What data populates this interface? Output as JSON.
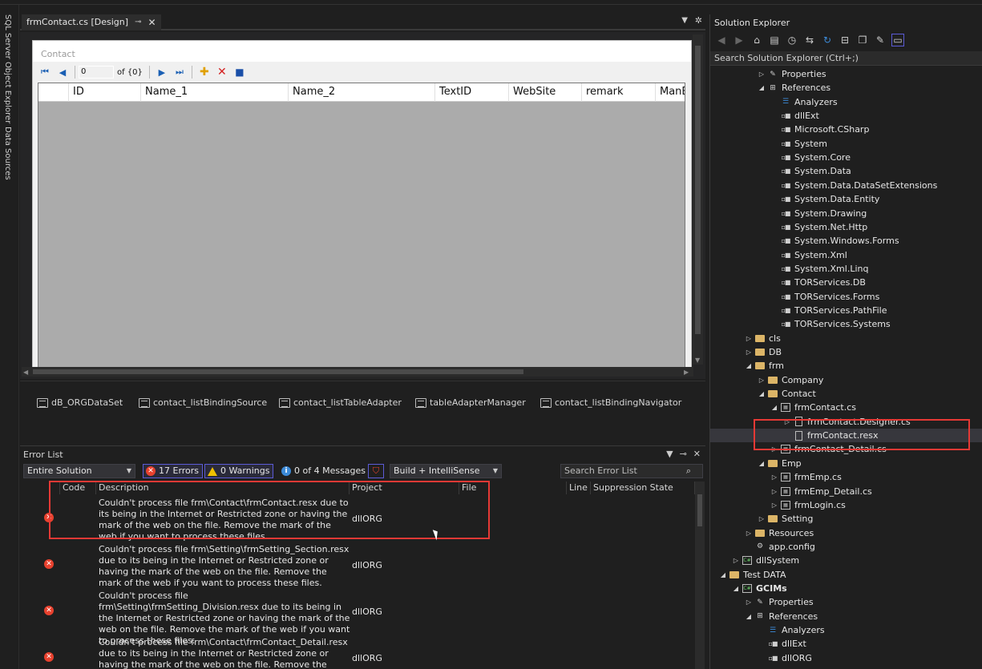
{
  "left_rail": [
    "SQL Server Object Explorer",
    "Data Sources"
  ],
  "designer": {
    "tab_label": "frmContact.cs [Design]",
    "form_title": "Contact",
    "navigator": {
      "position": "0",
      "count": "of {0}"
    },
    "columns": [
      "ID",
      "Name_1",
      "Name_2",
      "TextID",
      "WebSite",
      "remark",
      "ManEd"
    ]
  },
  "tray": [
    "dB_ORGDataSet",
    "contact_listBindingSource",
    "contact_listTableAdapter",
    "tableAdapterManager",
    "contact_listBindingNavigator"
  ],
  "error_list": {
    "title": "Error List",
    "scope": "Entire Solution",
    "errors": "17 Errors",
    "warnings": "0 Warnings",
    "messages": "0 of 4 Messages",
    "build_filter": "Build + IntelliSense",
    "search_placeholder": "Search Error List",
    "headers": [
      "Code",
      "Description",
      "Project",
      "File",
      "Line",
      "Suppression State"
    ],
    "rows": [
      {
        "description": "Couldn't process file frm\\Contact\\frmContact.resx due to its being in the Internet or Restricted zone or having the mark of the web on the file. Remove the mark of the web if you want to process these files.",
        "project": "dllORG"
      },
      {
        "description": "Couldn't process file frm\\Setting\\frmSetting_Section.resx due to its being in the Internet or Restricted zone or having the mark of the web on the file. Remove the mark of the web if you want to process these files.",
        "project": "dllORG"
      },
      {
        "description": "Couldn't process file frm\\Setting\\frmSetting_Division.resx due to its being in the Internet or Restricted zone or having the mark of the web on the file. Remove the mark of the web if you want to process these files.",
        "project": "dllORG"
      },
      {
        "description": "Couldn't process file frm\\Contact\\frmContact_Detail.resx due to its being in the Internet or Restricted zone or having the mark of the web on the file. Remove the mark of the web if you want to",
        "project": "dllORG"
      }
    ]
  },
  "solution_explorer": {
    "title": "Solution Explorer",
    "search_placeholder": "Search Solution Explorer (Ctrl+;)",
    "nodes": [
      {
        "label": "Properties",
        "icon": "wrench-icon",
        "exp": "collapsed"
      },
      {
        "label": "References",
        "icon": "references-icon",
        "exp": "expanded"
      },
      {
        "label": "Analyzers",
        "icon": "analyzers-icon",
        "exp": ""
      },
      {
        "label": "dllExt",
        "icon": "reference-icon",
        "exp": ""
      },
      {
        "label": "Microsoft.CSharp",
        "icon": "reference-icon",
        "exp": ""
      },
      {
        "label": "System",
        "icon": "reference-icon",
        "exp": ""
      },
      {
        "label": "System.Core",
        "icon": "reference-icon",
        "exp": ""
      },
      {
        "label": "System.Data",
        "icon": "reference-icon",
        "exp": ""
      },
      {
        "label": "System.Data.DataSetExtensions",
        "icon": "reference-icon",
        "exp": ""
      },
      {
        "label": "System.Data.Entity",
        "icon": "reference-icon",
        "exp": ""
      },
      {
        "label": "System.Drawing",
        "icon": "reference-icon",
        "exp": ""
      },
      {
        "label": "System.Net.Http",
        "icon": "reference-icon",
        "exp": ""
      },
      {
        "label": "System.Windows.Forms",
        "icon": "reference-icon",
        "exp": ""
      },
      {
        "label": "System.Xml",
        "icon": "reference-icon",
        "exp": ""
      },
      {
        "label": "System.Xml.Linq",
        "icon": "reference-icon",
        "exp": ""
      },
      {
        "label": "TORServices.DB",
        "icon": "reference-icon",
        "exp": ""
      },
      {
        "label": "TORServices.Forms",
        "icon": "reference-icon",
        "exp": ""
      },
      {
        "label": "TORServices.PathFile",
        "icon": "reference-icon",
        "exp": ""
      },
      {
        "label": "TORServices.Systems",
        "icon": "reference-icon",
        "exp": ""
      },
      {
        "label": "cls",
        "icon": "folder-icon",
        "exp": "collapsed"
      },
      {
        "label": "DB",
        "icon": "folder-icon",
        "exp": "collapsed"
      },
      {
        "label": "frm",
        "icon": "folder-icon",
        "exp": "expanded"
      },
      {
        "label": "Company",
        "icon": "folder-icon",
        "exp": "collapsed"
      },
      {
        "label": "Contact",
        "icon": "folder-icon",
        "exp": "expanded"
      },
      {
        "label": "frmContact.cs",
        "icon": "form-icon",
        "exp": "expanded"
      },
      {
        "label": "frmContact.Designer.cs",
        "icon": "cs-file-icon",
        "exp": "collapsed"
      },
      {
        "label": "frmContact.resx",
        "icon": "resx-file-icon",
        "exp": ""
      },
      {
        "label": "frmContact_Detail.cs",
        "icon": "form-icon",
        "exp": "collapsed"
      },
      {
        "label": "Emp",
        "icon": "folder-icon",
        "exp": "expanded"
      },
      {
        "label": "frmEmp.cs",
        "icon": "form-icon",
        "exp": "collapsed"
      },
      {
        "label": "frmEmp_Detail.cs",
        "icon": "form-icon",
        "exp": "collapsed"
      },
      {
        "label": "frmLogin.cs",
        "icon": "form-icon",
        "exp": "collapsed"
      },
      {
        "label": "Setting",
        "icon": "folder-icon",
        "exp": "collapsed"
      },
      {
        "label": "Resources",
        "icon": "folder-icon",
        "exp": "collapsed"
      },
      {
        "label": "app.config",
        "icon": "config-icon",
        "exp": ""
      },
      {
        "label": "dllSystem",
        "icon": "csproj-icon",
        "exp": "collapsed"
      },
      {
        "label": "Test DATA",
        "icon": "folder-icon",
        "exp": "expanded"
      },
      {
        "label": "GCIMs",
        "icon": "csproj-icon",
        "exp": "expanded"
      },
      {
        "label": "Properties",
        "icon": "wrench-icon",
        "exp": "collapsed"
      },
      {
        "label": "References",
        "icon": "references-icon",
        "exp": "expanded"
      },
      {
        "label": "Analyzers",
        "icon": "analyzers-icon",
        "exp": ""
      },
      {
        "label": "dllExt",
        "icon": "reference-icon",
        "exp": ""
      },
      {
        "label": "dllORG",
        "icon": "reference-icon",
        "exp": ""
      }
    ]
  }
}
